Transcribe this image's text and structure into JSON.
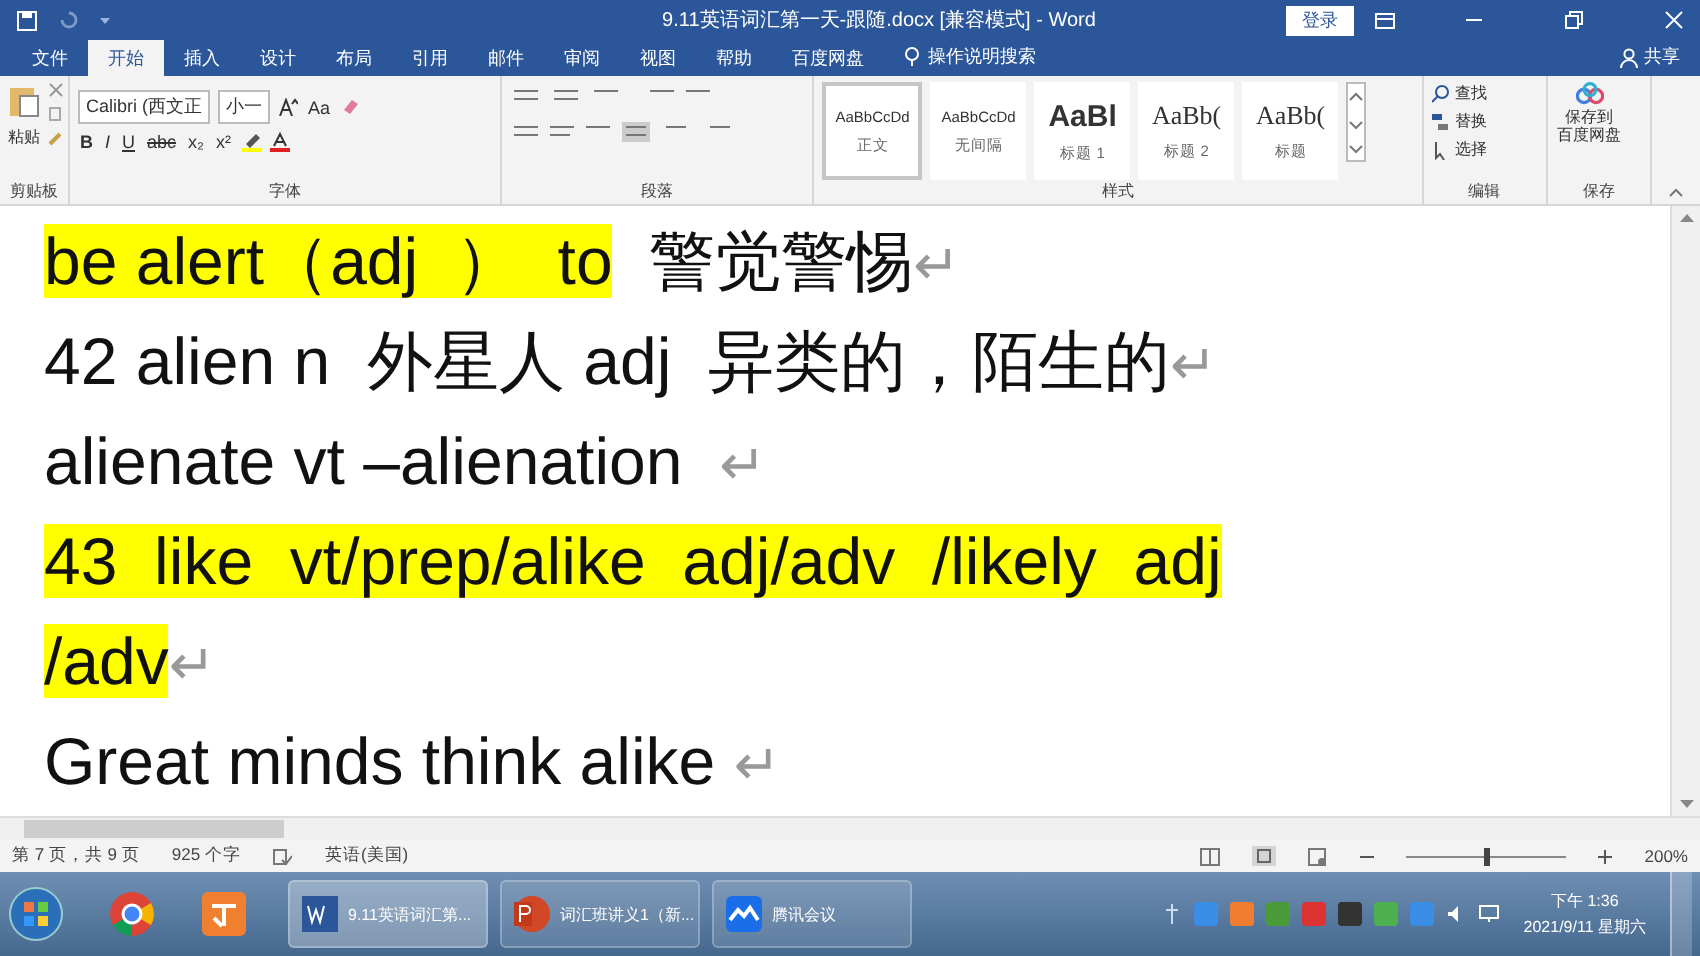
{
  "window": {
    "title": "9.11英语词汇第一天-跟随.docx [兼容模式] - Word",
    "login_button": "登录"
  },
  "tabs": [
    {
      "label": "文件",
      "selected": false
    },
    {
      "label": "开始",
      "selected": true
    },
    {
      "label": "插入",
      "selected": false
    },
    {
      "label": "设计",
      "selected": false
    },
    {
      "label": "布局",
      "selected": false
    },
    {
      "label": "引用",
      "selected": false
    },
    {
      "label": "邮件",
      "selected": false
    },
    {
      "label": "审阅",
      "selected": false
    },
    {
      "label": "视图",
      "selected": false
    },
    {
      "label": "帮助",
      "selected": false
    },
    {
      "label": "百度网盘",
      "selected": false
    }
  ],
  "tell_me": "操作说明搜索",
  "share": "共享",
  "ribbon": {
    "clipboard": {
      "paste": "粘贴",
      "label": "剪贴板"
    },
    "font": {
      "name": "Calibri (西文正",
      "size": "小一",
      "case_button": "Aa",
      "format_buttons": [
        "B",
        "I",
        "U",
        "abc",
        "x₂",
        "x²"
      ],
      "label": "字体"
    },
    "paragraph": {
      "label": "段落"
    },
    "styles": {
      "items": [
        {
          "sample": "AaBbCcDd",
          "name": "正文",
          "kind": "small",
          "selected": true
        },
        {
          "sample": "AaBbCcDd",
          "name": "无间隔",
          "kind": "small",
          "selected": false
        },
        {
          "sample": "AaBl",
          "name": "标题 1",
          "kind": "heading",
          "selected": false
        },
        {
          "sample": "AaBb(",
          "name": "标题 2",
          "kind": "serif",
          "selected": false
        },
        {
          "sample": "AaBb(",
          "name": "标题",
          "kind": "serif",
          "selected": false
        }
      ],
      "label": "样式"
    },
    "editing": {
      "items": [
        "查找",
        "替换",
        "选择"
      ],
      "label": "编辑"
    },
    "save": {
      "button": [
        "保存到",
        "百度网盘"
      ],
      "label": "保存"
    }
  },
  "document": {
    "lines": [
      {
        "segments": [
          {
            "text": "be alert（adj  ）  to",
            "highlighted": true
          },
          {
            "text": "  警觉警惕",
            "highlighted": false
          }
        ],
        "paragraph_mark": "↵"
      },
      {
        "segments": [
          {
            "text": "42 alien n  外星人 adj  异类的，陌生的",
            "highlighted": false
          }
        ],
        "paragraph_mark": "↵"
      },
      {
        "segments": [
          {
            "text": "alienate vt –alienation  ",
            "highlighted": false
          }
        ],
        "paragraph_mark": "↵"
      },
      {
        "segments": [
          {
            "text": "43  like  vt/prep/alike  adj/adv  /likely  adj",
            "highlighted": true
          }
        ]
      },
      {
        "segments": [
          {
            "text": "/adv",
            "highlighted": true
          }
        ],
        "paragraph_mark": "↵"
      },
      {
        "segments": [
          {
            "text": "Great minds think alike ",
            "highlighted": false
          }
        ],
        "paragraph_mark": "↵"
      }
    ]
  },
  "status_bar": {
    "page": "第 7 页，共 9 页",
    "words": "925 个字",
    "language": "英语(美国)",
    "zoom": "200%",
    "zoom_slider": {
      "level": 0.5
    }
  },
  "taskbar": {
    "tasks": [
      {
        "label": "9.11英语词汇第...",
        "kind": "word",
        "selected": true
      },
      {
        "label": "词汇班讲义1（新...",
        "kind": "powerpoint",
        "selected": false
      },
      {
        "label": "腾讯会议",
        "kind": "meeting",
        "selected": false
      }
    ],
    "time": "下午 1:36",
    "date": "2021/9/11 星期六"
  }
}
